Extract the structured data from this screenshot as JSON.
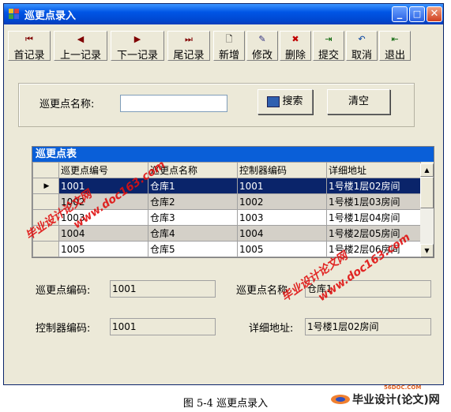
{
  "window": {
    "title": "巡更点录入"
  },
  "title_buttons": {
    "minimize": "_",
    "maximize": "□",
    "close": "✕"
  },
  "toolbar": [
    {
      "name": "first",
      "label": "首记录",
      "icon": "first-record-icon",
      "glyph": "⏮"
    },
    {
      "name": "prev",
      "label": "上一记录",
      "icon": "prev-record-icon",
      "glyph": "◀"
    },
    {
      "name": "next",
      "label": "下一记录",
      "icon": "next-record-icon",
      "glyph": "▶"
    },
    {
      "name": "last",
      "label": "尾记录",
      "icon": "last-record-icon",
      "glyph": "⏭"
    },
    {
      "name": "add",
      "label": "新增",
      "icon": "new-file-icon",
      "glyph": "🗋"
    },
    {
      "name": "edit",
      "label": "修改",
      "icon": "edit-icon",
      "glyph": "✎"
    },
    {
      "name": "delete",
      "label": "删除",
      "icon": "delete-icon",
      "glyph": "✖"
    },
    {
      "name": "submit",
      "label": "提交",
      "icon": "submit-icon",
      "glyph": "⇥"
    },
    {
      "name": "cancel",
      "label": "取消",
      "icon": "undo-icon",
      "glyph": "↶"
    },
    {
      "name": "exit",
      "label": "退出",
      "icon": "exit-icon",
      "glyph": "⇤"
    }
  ],
  "search": {
    "label": "巡更点名称:",
    "value": "",
    "search_button": "搜索",
    "clear_button": "清空"
  },
  "grid": {
    "caption": "巡更点表",
    "columns": [
      "巡更点编号",
      "巡更点名称",
      "控制器编码",
      "详细地址"
    ],
    "rows": [
      [
        "1001",
        "仓库1",
        "1001",
        "1号楼1层02房间"
      ],
      [
        "1002",
        "仓库2",
        "1002",
        "1号楼1层03房间"
      ],
      [
        "1003",
        "仓库3",
        "1003",
        "1号楼1层04房间"
      ],
      [
        "1004",
        "仓库4",
        "1004",
        "1号楼2层05房间"
      ],
      [
        "1005",
        "仓库5",
        "1005",
        "1号楼2层06房间"
      ]
    ],
    "current_row_marker": "▶"
  },
  "detail": {
    "code_label": "巡更点编码:",
    "code_value": "1001",
    "name_label": "巡更点名称:",
    "name_value": "仓库1",
    "controller_label": "控制器编码:",
    "controller_value": "1001",
    "address_label": "详细地址:",
    "address_value": "1号楼1层02房间"
  },
  "figure_caption": "图 5-4  巡更点录入",
  "watermarks": {
    "text1": "毕业设计论文网",
    "text2": "www.doc163.com",
    "logo_small": "56DOC.COM",
    "logo_text": "毕业设计(论文)网"
  },
  "colors": {
    "titlebar": "#0055e5",
    "selection": "#0a246a",
    "caption_bar": "#0a5fd8",
    "watermark": "#e01010"
  }
}
